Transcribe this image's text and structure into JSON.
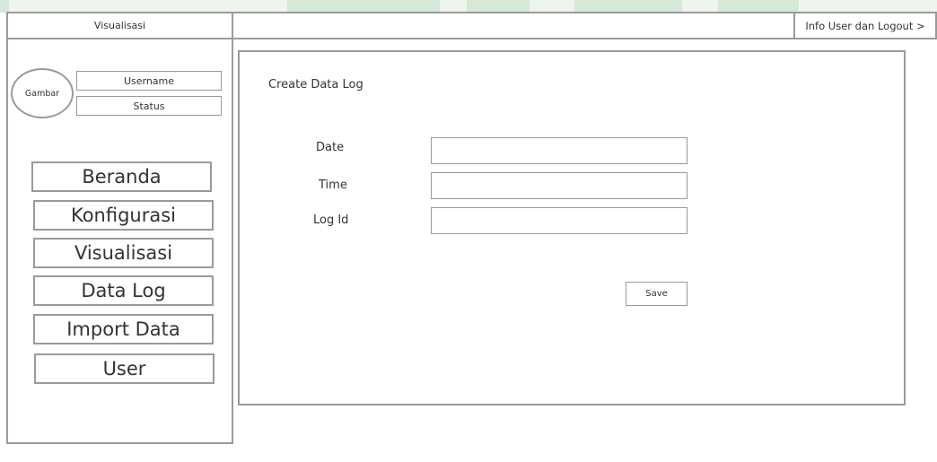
{
  "sidebar": {
    "title": "Visualisasi",
    "avatar_label": "Gambar",
    "username": "Username",
    "status": "Status",
    "menu": [
      "Beranda",
      "Konfigurasi",
      "Visualisasi",
      "Data Log",
      "Import Data",
      "User"
    ]
  },
  "header": {
    "user_link": "Info User dan Logout >"
  },
  "form": {
    "title": "Create Data Log",
    "fields": [
      {
        "label": "Date",
        "value": ""
      },
      {
        "label": "Time",
        "value": ""
      },
      {
        "label": "Log Id",
        "value": ""
      }
    ],
    "save_label": "Save"
  }
}
